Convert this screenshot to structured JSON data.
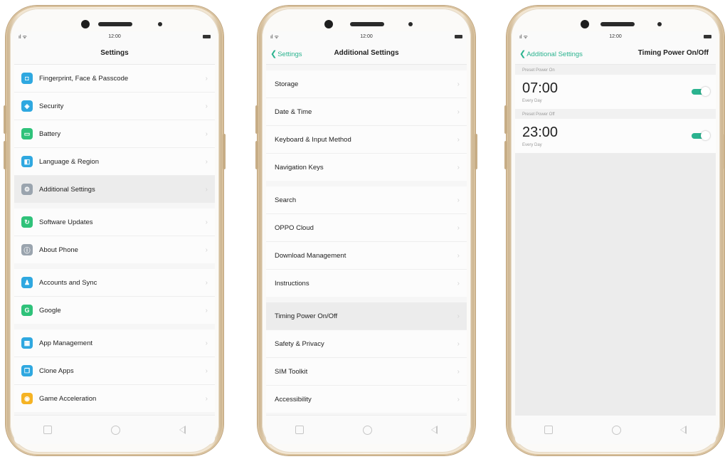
{
  "status": {
    "time": "12:00"
  },
  "phone1": {
    "title": "Settings",
    "groups": [
      [
        {
          "label": "Fingerprint, Face & Passcode",
          "icon": "fingerprint-icon",
          "color": "#2fa8e0",
          "glyph": "◘"
        },
        {
          "label": "Security",
          "icon": "shield-icon",
          "color": "#2fa8e0",
          "glyph": "◈"
        },
        {
          "label": "Battery",
          "icon": "battery-icon",
          "color": "#2fc27a",
          "glyph": "▭"
        },
        {
          "label": "Language & Region",
          "icon": "language-icon",
          "color": "#2fa8e0",
          "glyph": "◧"
        },
        {
          "label": "Additional Settings",
          "icon": "additional-settings-icon",
          "color": "#9aa4ae",
          "glyph": "⚙"
        }
      ],
      [
        {
          "label": "Software Updates",
          "icon": "update-icon",
          "color": "#2fc27a",
          "glyph": "↻"
        },
        {
          "label": "About Phone",
          "icon": "info-icon",
          "color": "#9aa4ae",
          "glyph": "ⓘ"
        }
      ],
      [
        {
          "label": "Accounts and Sync",
          "icon": "account-icon",
          "color": "#2fa8e0",
          "glyph": "♟"
        },
        {
          "label": "Google",
          "icon": "google-icon",
          "color": "#2fc27a",
          "glyph": "G"
        }
      ],
      [
        {
          "label": "App Management",
          "icon": "app-management-icon",
          "color": "#2fa8e0",
          "glyph": "▦"
        },
        {
          "label": "Clone Apps",
          "icon": "clone-apps-icon",
          "color": "#2fa8e0",
          "glyph": "❐"
        },
        {
          "label": "Game Acceleration",
          "icon": "game-icon",
          "color": "#f5b324",
          "glyph": "◉"
        }
      ]
    ]
  },
  "phone2": {
    "back": "Settings",
    "title": "Additional Settings",
    "groups": [
      [
        "Storage",
        "Date & Time",
        "Keyboard & Input Method",
        "Navigation Keys"
      ],
      [
        "Search",
        "OPPO Cloud",
        "Download Management",
        "Instructions"
      ],
      [
        "Timing Power On/Off",
        "Safety & Privacy",
        "SIM Toolkit",
        "Accessibility"
      ]
    ]
  },
  "phone3": {
    "back": "Additional Settings",
    "title": "Timing Power On/Off",
    "sections": [
      {
        "header": "Preset Power On",
        "time": "07:00",
        "repeat": "Every Day",
        "on": true
      },
      {
        "header": "Preset Power Off",
        "time": "23:00",
        "repeat": "Every Day",
        "on": true
      }
    ]
  },
  "colors": {
    "accent": "#2bb38f"
  }
}
